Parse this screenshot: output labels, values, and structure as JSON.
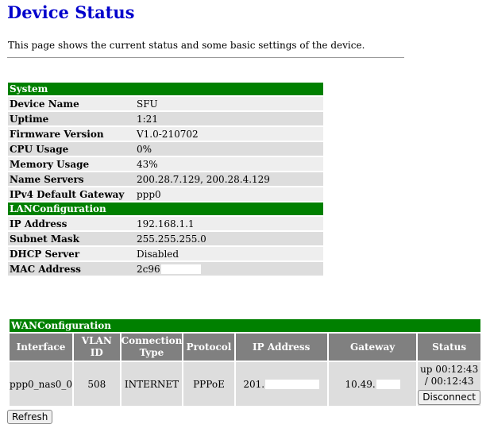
{
  "page": {
    "title": "Device Status",
    "description": "This page shows the current status and some basic settings of the device."
  },
  "system": {
    "header": "System",
    "rows": [
      {
        "label": "Device Name",
        "value": "SFU"
      },
      {
        "label": "Uptime",
        "value": "1:21"
      },
      {
        "label": "Firmware Version",
        "value": "V1.0-210702"
      },
      {
        "label": "CPU Usage",
        "value": "0%"
      },
      {
        "label": "Memory Usage",
        "value": "43%"
      },
      {
        "label": "Name Servers",
        "value": "200.28.7.129, 200.28.4.129"
      },
      {
        "label": "IPv4 Default Gateway",
        "value": "ppp0"
      }
    ]
  },
  "lan": {
    "header": "LANConfiguration",
    "rows": [
      {
        "label": "IP Address",
        "value": "192.168.1.1"
      },
      {
        "label": "Subnet Mask",
        "value": "255.255.255.0"
      },
      {
        "label": "DHCP Server",
        "value": "Disabled"
      },
      {
        "label": "MAC Address",
        "value": "2c96"
      }
    ]
  },
  "wan": {
    "header": "WANConfiguration",
    "columns": [
      "Interface",
      "VLAN ID",
      "Connection Type",
      "Protocol",
      "IP Address",
      "Gateway",
      "Status"
    ],
    "row": {
      "interface": "ppp0_nas0_0",
      "vlan_id": "508",
      "connection_type": "INTERNET",
      "protocol": "PPPoE",
      "ip_address": "201.",
      "gateway": "10.49.",
      "status": "up 00:12:43 / 00:12:43",
      "disconnect_label": "Disconnect"
    }
  },
  "actions": {
    "refresh_label": "Refresh"
  }
}
